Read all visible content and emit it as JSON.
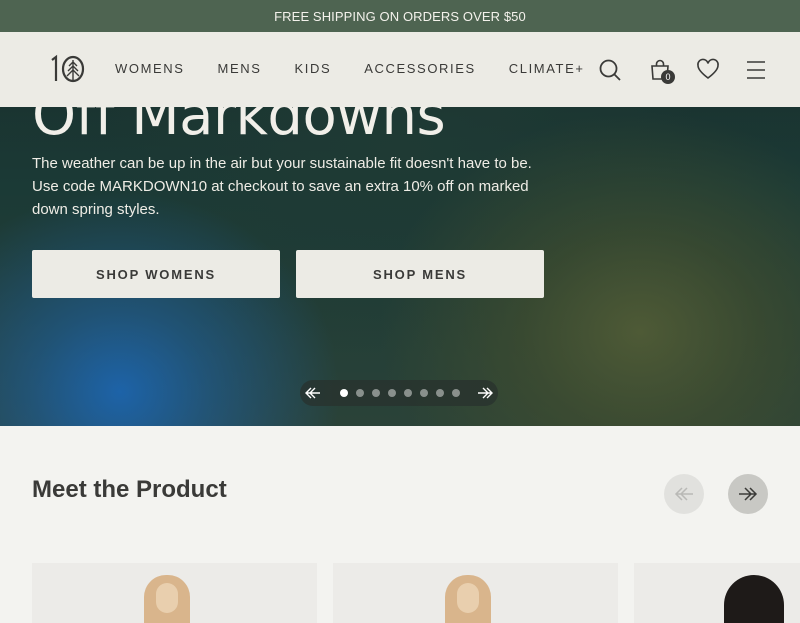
{
  "announcement": "FREE SHIPPING ON ORDERS OVER $50",
  "header": {
    "logo_text": "10",
    "nav": [
      "WOMENS",
      "MENS",
      "KIDS",
      "ACCESSORIES",
      "CLIMATE+"
    ],
    "cart_count": "0",
    "icons": [
      "search-icon",
      "cart-icon",
      "heart-icon",
      "menu-icon"
    ]
  },
  "hero": {
    "title": "Off Markdowns",
    "body": "The weather can be up in the air but your sustainable fit doesn't have to be. Use code MARKDOWN10 at checkout to save an extra 10% off on marked down spring styles.",
    "buttons": {
      "womens": "SHOP WOMENS",
      "mens": "SHOP MENS"
    },
    "carousel": {
      "slides": 8,
      "active": 1
    }
  },
  "products": {
    "title": "Meet the Product"
  },
  "colors": {
    "announce_bg": "#4e6451",
    "header_bg": "#ecebe5",
    "text": "#3a3a38"
  }
}
